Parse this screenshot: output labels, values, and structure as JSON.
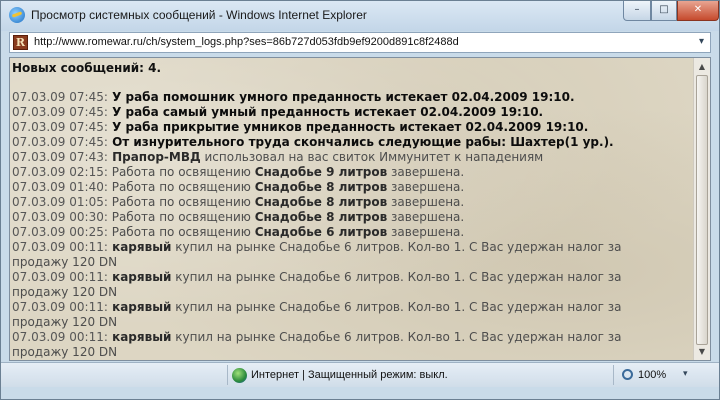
{
  "window": {
    "title": "Просмотр системных сообщений - Windows Internet Explorer",
    "minimize": "–",
    "maximize": "□",
    "close": "✕"
  },
  "address": {
    "url": "http://www.romewar.ru/ch/system_logs.php?ses=86b727d053fdb9ef9200d891c8f2488d",
    "site_icon": "R",
    "dropdown": "▾"
  },
  "content": {
    "message_count": "Новых сообщений: 4.",
    "lines": [
      {
        "ts": "07.03.09 07:45:",
        "parts": [
          " У раба помошник умного преданность истекает 02.04.2009 19:10."
        ],
        "bold": true
      },
      {
        "ts": "07.03.09 07:45:",
        "parts": [
          " У раба самый умный преданность истекает 02.04.2009 19:10."
        ],
        "bold": true
      },
      {
        "ts": "07.03.09 07:45:",
        "parts": [
          " У раба прикрытие умников преданность истекает 02.04.2009 19:10."
        ],
        "bold": true
      },
      {
        "ts": "07.03.09 07:45:",
        "parts": [
          " От изнурительного труда скончались следующие рабы: Шахтер(1 ур.)."
        ],
        "bold": true
      },
      {
        "ts": "07.03.09 07:43:",
        "b1": " Прапор-МВД",
        "t1": " использовал на вас свиток Иммунитет к нападениям"
      },
      {
        "ts": "07.03.09 02:15:",
        "t0": " Работа по освящению ",
        "b1": "Снадобье 9 литров",
        "t1": " завершена."
      },
      {
        "ts": "07.03.09 01:40:",
        "t0": " Работа по освящению ",
        "b1": "Снадобье 8 литров",
        "t1": " завершена."
      },
      {
        "ts": "07.03.09 01:05:",
        "t0": " Работа по освящению ",
        "b1": "Снадобье 8 литров",
        "t1": " завершена."
      },
      {
        "ts": "07.03.09 00:30:",
        "t0": " Работа по освящению ",
        "b1": "Снадобье 8 литров",
        "t1": " завершена."
      },
      {
        "ts": "07.03.09 00:25:",
        "t0": " Работа по освящению ",
        "b1": "Снадобье 6 литров",
        "t1": " завершена."
      },
      {
        "ts": "07.03.09 00:11:",
        "b1": " карявый",
        "t1": " купил на рынке Снадобье 6 литров. Кол-во 1. С Вас удержан налог за продажу 120 DN"
      },
      {
        "ts": "07.03.09 00:11:",
        "b1": " карявый",
        "t1": " купил на рынке Снадобье 6 литров. Кол-во 1. С Вас удержан налог за продажу 120 DN"
      },
      {
        "ts": "07.03.09 00:11:",
        "b1": " карявый",
        "t1": " купил на рынке Снадобье 6 литров. Кол-во 1. С Вас удержан налог за продажу 120 DN"
      },
      {
        "ts": "07.03.09 00:11:",
        "b1": " карявый",
        "t1": " купил на рынке Снадобье 6 литров. Кол-во 1. С Вас удержан налог за продажу 120 DN"
      }
    ]
  },
  "status": {
    "zone_text": "Интернет | Защищенный режим: выкл.",
    "zoom": "100%",
    "zoom_dropdown": "▾"
  },
  "colors": {
    "content_bg": "#ddd6c3",
    "frame": "#c9dbe9",
    "close_button": "#c54a2d"
  },
  "icons": [
    "ie-icon",
    "site-favicon",
    "globe-icon",
    "zoom-icon"
  ]
}
